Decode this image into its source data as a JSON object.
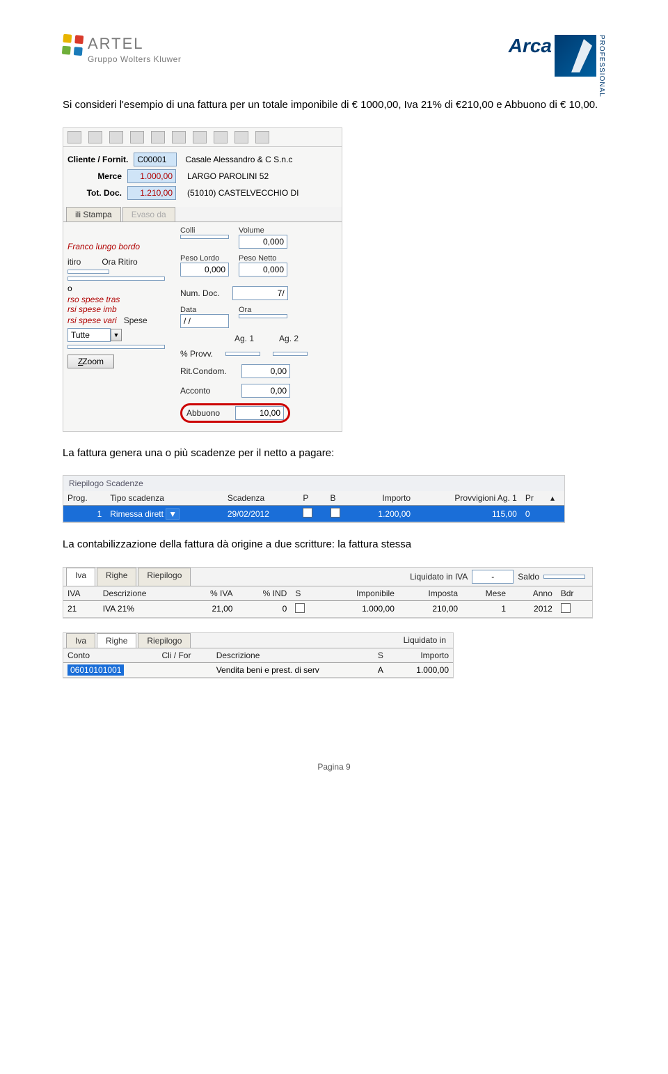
{
  "header": {
    "artel": "ARTEL",
    "artel_sub": "Gruppo Wolters Kluwer",
    "arca": "Arca",
    "arca_prof": "PROFESSIONAL"
  },
  "intro": "Si consideri l'esempio di una fattura per un totale imponibile di € 1000,00, Iva 21% di €210,00 e Abbuono di € 10,00.",
  "form": {
    "cliente_lbl": "Cliente / Fornit.",
    "cliente_code": "C00001",
    "cliente_name": "Casale Alessandro & C S.n.c",
    "merce_lbl": "Merce",
    "merce_val": "1.000,00",
    "addr1": "LARGO PAROLINI 52",
    "addr2": "(51010) CASTELVECCHIO DI",
    "totdoc_lbl": "Tot. Doc.",
    "totdoc_val": "1.210,00",
    "tab1": "ili Stampa",
    "tab2": "Evaso da",
    "colli": "Colli",
    "volume": "Volume",
    "volume_v": "0,000",
    "franco": "Franco lungo bordo",
    "pesolordo": "Peso Lordo",
    "pesolordo_v": "0,000",
    "pesonetto": "Peso Netto",
    "pesonetto_v": "0,000",
    "ritiro": "itiro",
    "oraritiro": "Ora Ritiro",
    "numdoc": "Num. Doc.",
    "numdoc_v": "7/",
    "data": "Data",
    "data_v": "/ /",
    "ora": "Ora",
    "sp1": "rso spese tras",
    "sp2": "rsi spese imb",
    "sp3": "rsi spese vari",
    "ag1": "Ag. 1",
    "ag2": "Ag. 2",
    "spese": "Spese",
    "provv": "% Provv.",
    "tutte": "Tutte",
    "ritcondom": "Rit.Condom.",
    "ritcondom_v": "0,00",
    "acconto": "Acconto",
    "acconto_v": "0,00",
    "zoom": "Zoom",
    "abbuono": "Abbuono",
    "abbuono_v": "10,00"
  },
  "para2": "La fattura genera una o più scadenze per il netto a pagare:",
  "riepilogo": {
    "title": "Riepilogo Scadenze",
    "cols": [
      "Prog.",
      "Tipo scadenza",
      "Scadenza",
      "P",
      "B",
      "Importo",
      "Provvigioni Ag. 1",
      "Pr"
    ],
    "row": {
      "prog": "1",
      "tipo": "Rimessa dirett",
      "scad": "29/02/2012",
      "importo": "1.200,00",
      "prov": "115,00",
      "pr": "0"
    }
  },
  "para3": "La contabilizzazione della fattura dà origine a due scritture: la fattura stessa",
  "iva": {
    "tabs": [
      "Iva",
      "Righe",
      "Riepilogo"
    ],
    "liq_lbl": "Liquidato in IVA",
    "liq_v": "-",
    "saldo": "Saldo",
    "cols": [
      "IVA",
      "Descrizione",
      "% IVA",
      "% IND",
      "S",
      "Imponibile",
      "Imposta",
      "Mese",
      "Anno",
      "Bdr"
    ],
    "row": {
      "iva": "21",
      "desc": "IVA 21%",
      "pctiva": "21,00",
      "pctind": "0",
      "imp": "1.000,00",
      "imposta": "210,00",
      "mese": "1",
      "anno": "2012"
    }
  },
  "righe": {
    "tabs": [
      "Iva",
      "Righe",
      "Riepilogo"
    ],
    "liq_lbl": "Liquidato in",
    "cols": [
      "Conto",
      "Cli / For",
      "Descrizione",
      "S",
      "Importo"
    ],
    "row": {
      "conto": "06010101001",
      "desc": "Vendita beni e prest. di serv",
      "s": "A",
      "imp": "1.000,00"
    }
  },
  "footer": "Pagina 9"
}
